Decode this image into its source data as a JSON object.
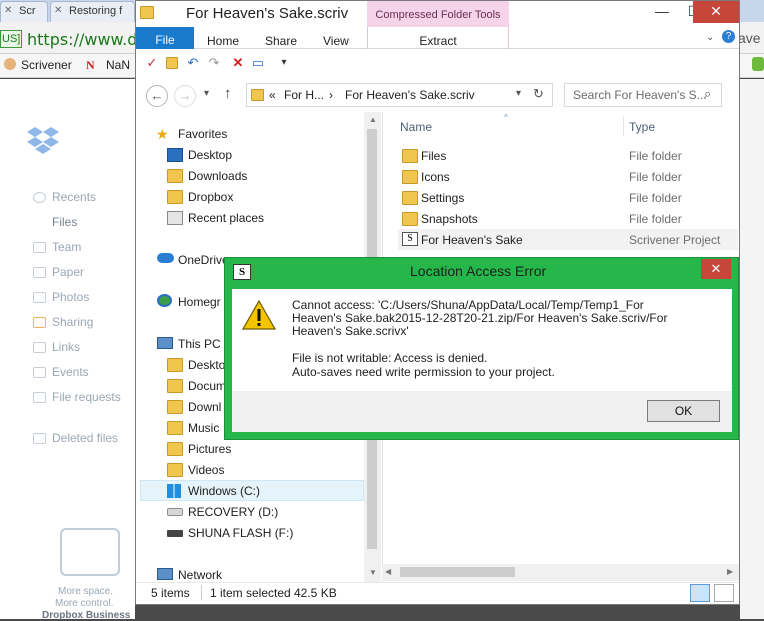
{
  "browser": {
    "tabs": [
      "Scr",
      "Restoring f"
    ],
    "url_badge": "US]",
    "url": "https://www.dr",
    "bookmarks": [
      "Scrivener",
      "NaN"
    ],
    "right_peek": "ave"
  },
  "dropbox": {
    "nav": [
      "Recents",
      "Files",
      "Team",
      "Paper",
      "Photos",
      "Sharing",
      "Links",
      "Events",
      "File requests",
      "Deleted files"
    ],
    "promo": [
      "More space.",
      "More control.",
      "Dropbox Business"
    ]
  },
  "explorer": {
    "title": "For Heaven's Sake.scriv",
    "context_tab": "Compressed Folder Tools",
    "ribbon_tabs": [
      "File",
      "Home",
      "Share",
      "View",
      "Extract"
    ],
    "breadcrumb": [
      "«",
      "For H...",
      "›",
      "For Heaven's Sake.scriv"
    ],
    "search_placeholder": "Search For Heaven's S...",
    "nav_pane": {
      "favorites": "Favorites",
      "favorites_items": [
        "Desktop",
        "Downloads",
        "Dropbox",
        "Recent places"
      ],
      "onedrive": "OneDrive",
      "homegroup": "Homegr",
      "this_pc": "This PC",
      "pc_items": [
        "Deskto",
        "Docum",
        "Downl",
        "Music",
        "Pictures",
        "Videos"
      ],
      "drives": [
        "Windows (C:)",
        "RECOVERY (D:)",
        "SHUNA FLASH (F:)"
      ],
      "network": "Network"
    },
    "columns": {
      "name": "Name",
      "type": "Type"
    },
    "files": [
      {
        "name": "Files",
        "type": "File folder"
      },
      {
        "name": "Icons",
        "type": "File folder"
      },
      {
        "name": "Settings",
        "type": "File folder"
      },
      {
        "name": "Snapshots",
        "type": "File folder"
      },
      {
        "name": "For Heaven's Sake",
        "type": "Scrivener Project"
      }
    ],
    "status": {
      "count": "5 items",
      "selected": "1 item selected",
      "size": "42.5 KB"
    }
  },
  "dialog": {
    "title": "Location Access Error",
    "app_icon_letter": "S",
    "message_lines": [
      "Cannot access: 'C:/Users/Shuna/AppData/Local/Temp/Temp1_For",
      "Heaven's Sake.bak2015-12-28T20-21.zip/For Heaven's Sake.scriv/For",
      "Heaven's Sake.scrivx'"
    ],
    "detail_lines": [
      "File is not writable: Access is denied.",
      "Auto-saves need write permission to your project."
    ],
    "ok_label": "OK"
  },
  "colors": {
    "dialog_border": "#25b74a",
    "file_tab": "#1979ca",
    "context_tab": "#f5d4ea",
    "close_red": "#c7463c"
  }
}
